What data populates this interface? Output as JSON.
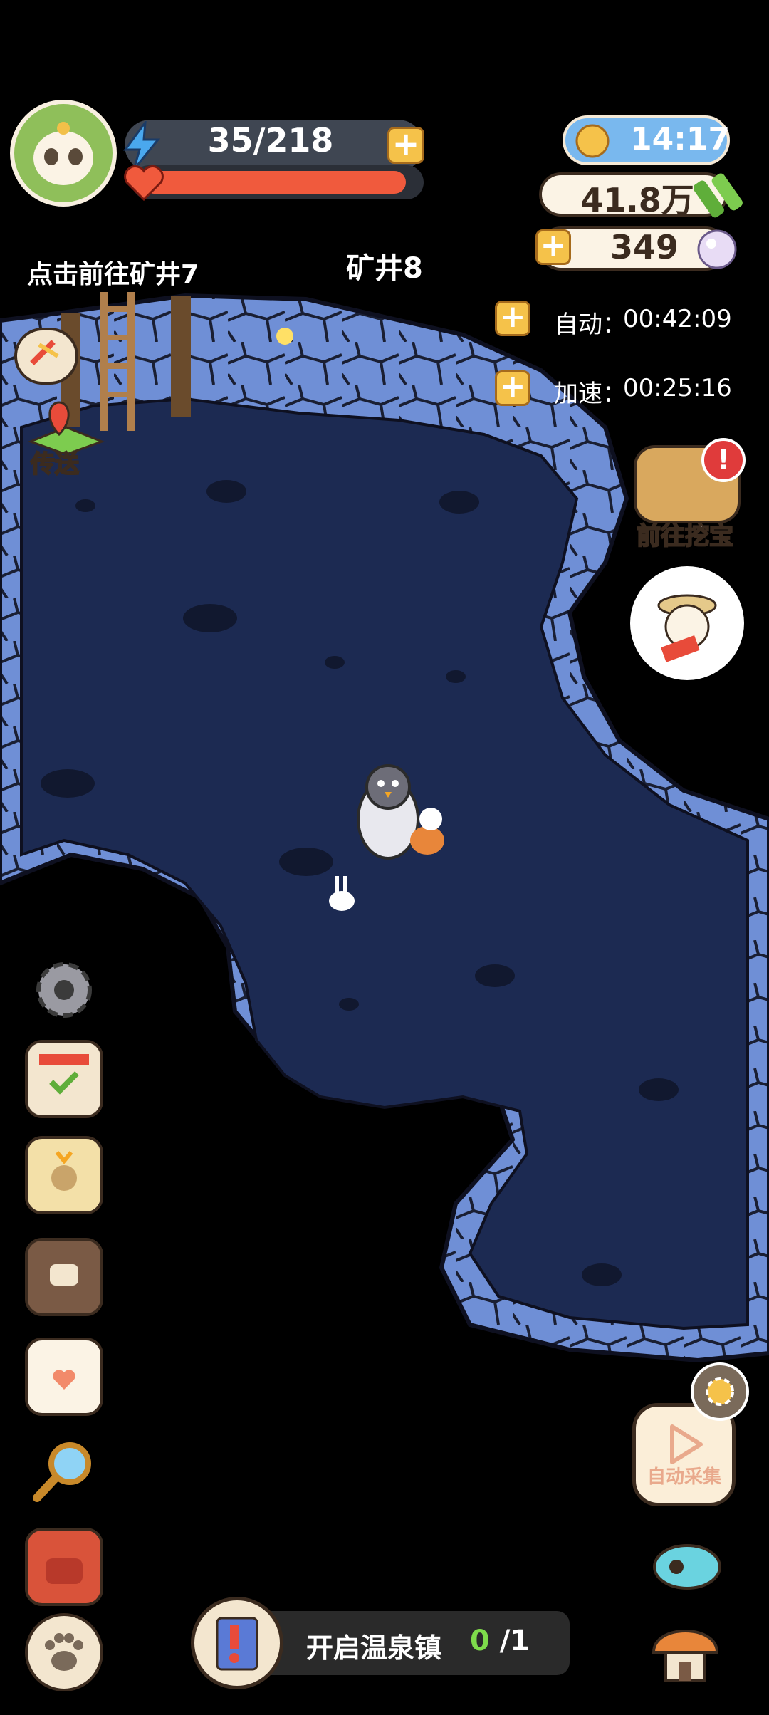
{
  "header": {
    "energy": "35/218",
    "time": "14:17",
    "coins": "41.8万",
    "pearls": "349"
  },
  "location": {
    "goto_prev_mine": "点击前往矿井7",
    "current_mine": "矿井8"
  },
  "boosts": [
    {
      "label": "自动：",
      "timer": "00:42:09"
    },
    {
      "label": "加速：",
      "timer": "00:25:16"
    }
  ],
  "side_actions": {
    "teleport": "传送",
    "treasure_hunt": "前往挖宝"
  },
  "quest": {
    "title": "开启温泉镇",
    "done": "0",
    "total": "/1"
  },
  "auto_collect": {
    "label": "自动采集"
  },
  "colors": {
    "cave_floor": "#1c2a52",
    "cave_wall": "#6f8fd6",
    "hp": "#f05a3d",
    "energy": "#4aa8ee",
    "gold": "#f5c24a"
  }
}
